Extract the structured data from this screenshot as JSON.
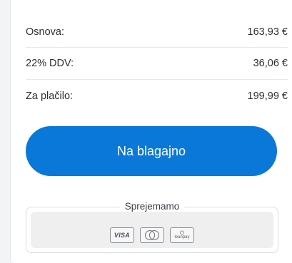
{
  "summary": {
    "rows": [
      {
        "label": "Osnova:",
        "value": "163,93 €"
      },
      {
        "label": "22% DDV:",
        "value": "36,06 €"
      },
      {
        "label": "Za plačilo:",
        "value": "199,99 €"
      }
    ]
  },
  "checkout": {
    "label": "Na blagajno"
  },
  "payments": {
    "title": "Sprejemamo",
    "methods": [
      {
        "icon": "visa-icon",
        "text": "VISA"
      },
      {
        "icon": "mastercard-icon",
        "text": "MasterCard"
      },
      {
        "icon": "leanpay-icon",
        "text": "leanpay"
      }
    ]
  },
  "colors": {
    "accent": "#0a78d8",
    "text": "#2b2f36",
    "divider": "#e6e8ec"
  }
}
